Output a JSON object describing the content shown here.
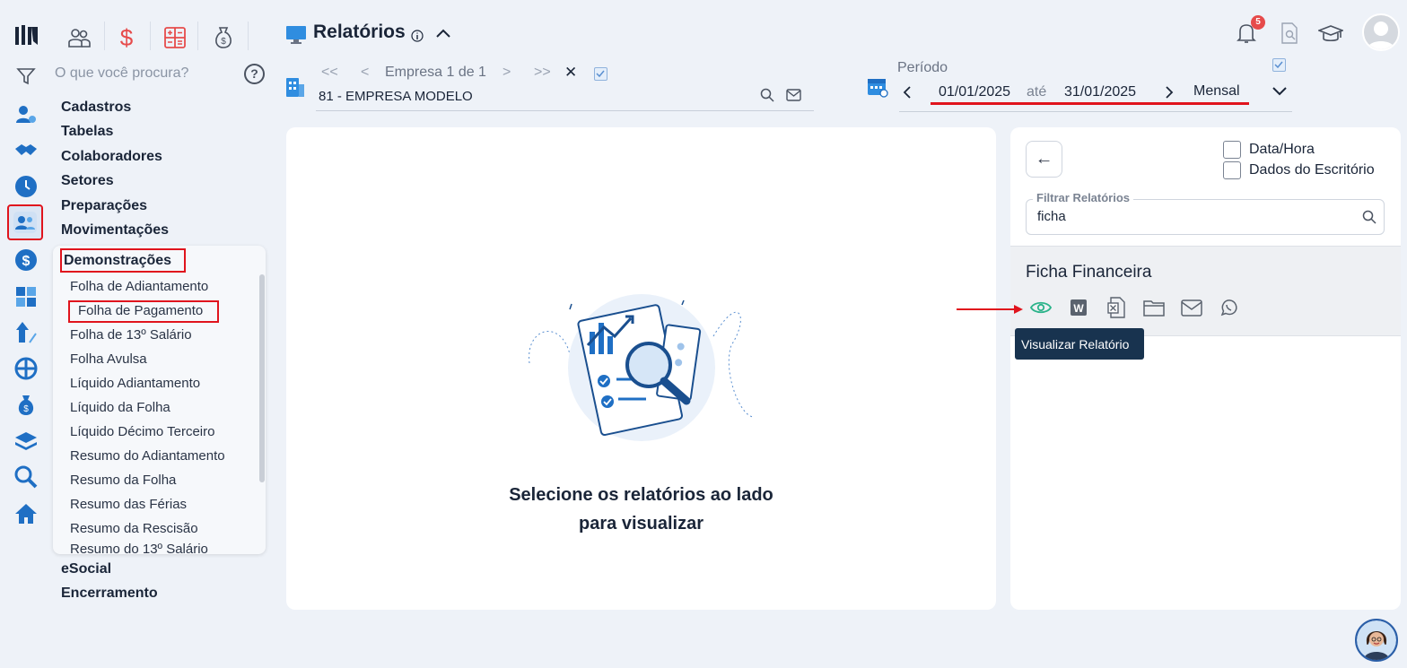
{
  "header": {
    "title": "Relatórios",
    "notifications_count": "5"
  },
  "search": {
    "placeholder": "O que você procura?",
    "help": "?"
  },
  "menu": {
    "top_items": [
      "Cadastros",
      "Tabelas",
      "Colaboradores",
      "Setores",
      "Preparações",
      "Movimentações"
    ],
    "expanded": "Demonstrações",
    "sub_items": [
      "Folha de Adiantamento",
      "Folha de Pagamento",
      "Folha de 13º Salário",
      "Folha Avulsa",
      "Líquido Adiantamento",
      "Líquido da Folha",
      "Líquido Décimo Terceiro",
      "Resumo do Adiantamento",
      "Resumo da Folha",
      "Resumo das Férias",
      "Resumo da Rescisão",
      "Resumo do 13º Salário"
    ],
    "bottom_items": [
      "eSocial",
      "Encerramento"
    ]
  },
  "company": {
    "nav_label": "Empresa 1 de 1",
    "value": "81 - EMPRESA MODELO",
    "first": "<<",
    "prev": "<",
    "next": ">",
    "last": ">>",
    "clear": "✕"
  },
  "period": {
    "label": "Período",
    "start": "01/01/2025",
    "separator": "até",
    "end": "31/01/2025",
    "mode": "Mensal"
  },
  "main": {
    "empty_line1": "Selecione os relatórios ao lado",
    "empty_line2": "para visualizar"
  },
  "reports": {
    "back": "←",
    "options": [
      "Data/Hora",
      "Dados do Escritório"
    ],
    "filter_legend": "Filtrar Relatórios",
    "filter_value": "ficha",
    "result_title": "Ficha Financeira",
    "tooltip": "Visualizar Relatório",
    "action_icons": [
      "eye-icon",
      "word-icon",
      "excel-icon",
      "folder-icon",
      "mail-icon",
      "whatsapp-icon"
    ]
  },
  "colors": {
    "accent": "#1f6fc4",
    "highlight": "#e0141d",
    "eye": "#2bb38a",
    "tooltip_bg": "#18334f"
  }
}
